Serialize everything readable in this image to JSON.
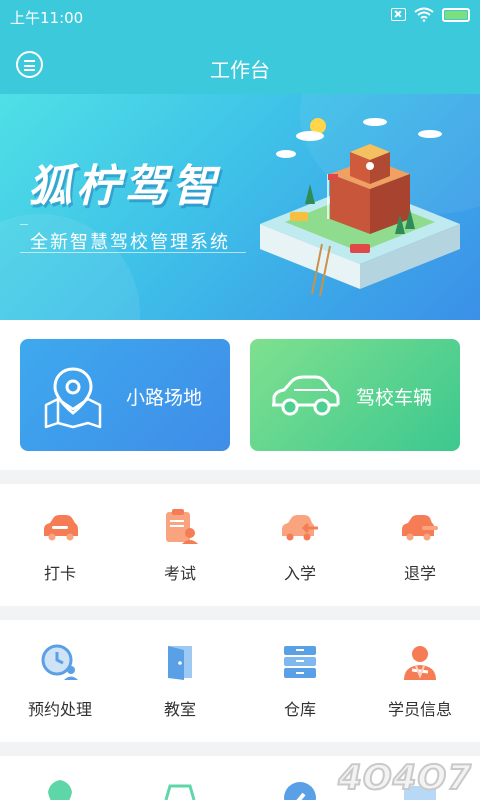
{
  "status_bar": {
    "time": "上午11:00"
  },
  "header": {
    "title": "工作台"
  },
  "banner": {
    "brand": "狐柠驾智",
    "slogan": "全新智慧驾校管理系统"
  },
  "cards": [
    {
      "label": "小路场地"
    },
    {
      "label": "驾校车辆"
    }
  ],
  "grid1": [
    {
      "label": "打卡",
      "icon": "car-icon"
    },
    {
      "label": "考试",
      "icon": "clipboard-icon"
    },
    {
      "label": "入学",
      "icon": "car-enter-icon"
    },
    {
      "label": "退学",
      "icon": "car-exit-icon"
    }
  ],
  "grid2": [
    {
      "label": "预约处理",
      "icon": "clock-user-icon"
    },
    {
      "label": "教室",
      "icon": "door-icon"
    },
    {
      "label": "仓库",
      "icon": "cabinet-icon"
    },
    {
      "label": "学员信息",
      "icon": "student-icon"
    }
  ],
  "watermark": "4O4O7",
  "colors": {
    "teal": "#3cc9dc",
    "orange": "#f57c55",
    "blue": "#3f8de8",
    "green": "#3cc88f"
  }
}
